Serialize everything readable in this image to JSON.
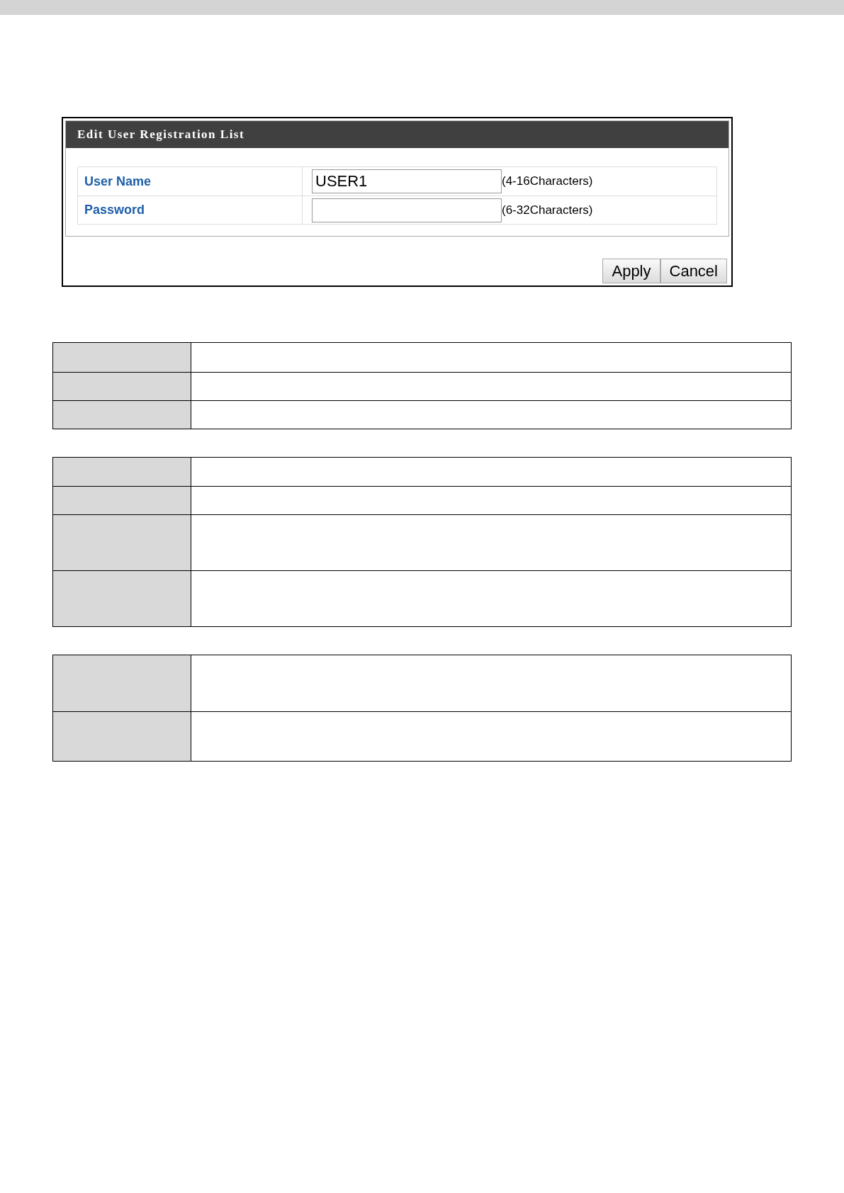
{
  "dialog": {
    "title": "Edit User Registration List",
    "fields": [
      {
        "label": "User Name",
        "value": "USER1",
        "hint": "(4-16Characters)"
      },
      {
        "label": "Password",
        "hint": "(6-32Characters)"
      }
    ],
    "buttons": [
      "Apply",
      "Cancel"
    ]
  }
}
